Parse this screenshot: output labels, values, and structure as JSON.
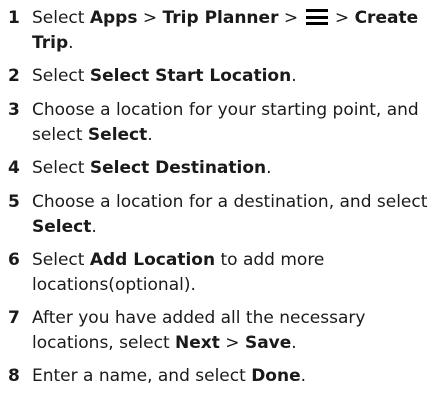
{
  "steps": [
    {
      "num": "1",
      "parts": [
        "Select ",
        "Apps",
        " > ",
        "Trip Planner",
        " > ",
        " > ",
        "Create Trip",
        "."
      ]
    },
    {
      "num": "2",
      "parts": [
        "Select ",
        "Select Start Location",
        "."
      ]
    },
    {
      "num": "3",
      "parts": [
        "Choose a location for your starting point, and select ",
        "Select",
        "."
      ]
    },
    {
      "num": "4",
      "parts": [
        "Select ",
        "Select Destination",
        "."
      ]
    },
    {
      "num": "5",
      "parts": [
        "Choose a location for a destination, and select ",
        "Select",
        "."
      ]
    },
    {
      "num": "6",
      "parts": [
        "Select ",
        "Add Location",
        " to add more locations(optional)."
      ]
    },
    {
      "num": "7",
      "parts": [
        "After you have added all the necessary locations, select ",
        "Next",
        " > ",
        "Save",
        "."
      ]
    },
    {
      "num": "8",
      "parts": [
        "Enter a name, and select ",
        "Done",
        "."
      ]
    }
  ],
  "icons": {
    "menu": "menu-icon"
  }
}
